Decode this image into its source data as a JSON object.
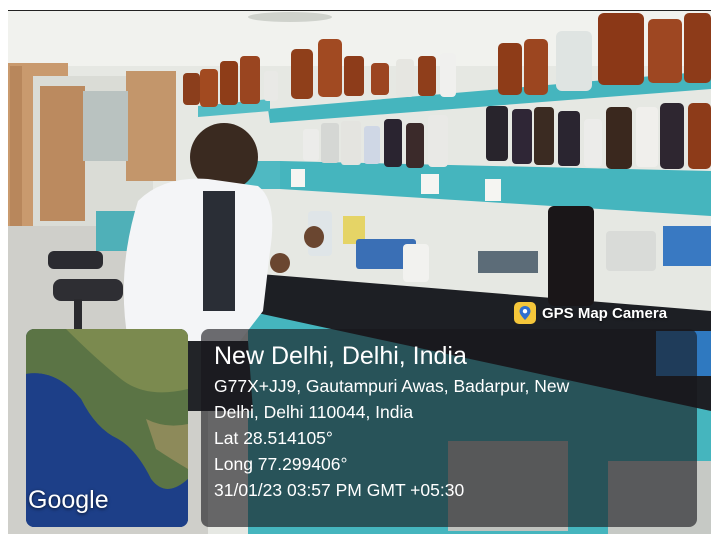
{
  "stamp": {
    "app_name": "GPS Map Camera",
    "city": "New Delhi, Delhi, India",
    "address_line_1": "G77X+JJ9, Gautampuri Awas, Badarpur, New",
    "address_line_2": "Delhi, Delhi 110044, India",
    "latitude": "Lat 28.514105°",
    "longitude": "Long 77.299406°",
    "datetime": "31/01/23 03:57 PM GMT +05:30"
  },
  "map": {
    "brand": "Google"
  },
  "icons": {
    "gps": "map-pin-icon"
  },
  "colors": {
    "shelf_teal": "#45b5be",
    "wall": "#e9ebe6",
    "overlay": "#16161c",
    "pin_badge": "#f4c63a"
  }
}
